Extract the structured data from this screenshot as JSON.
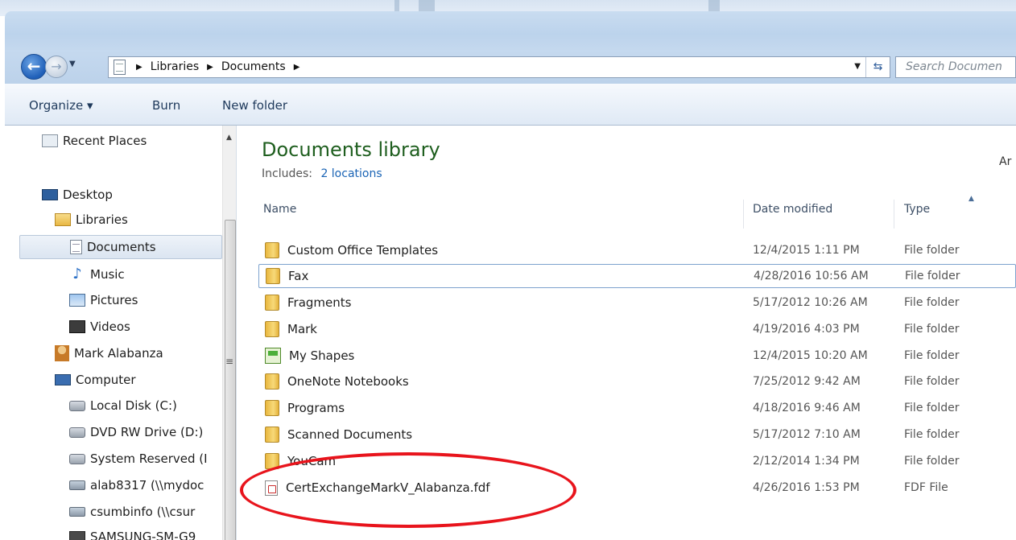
{
  "address_bar": {
    "crumbs": [
      "Libraries",
      "Documents"
    ],
    "search_placeholder": "Search Documen"
  },
  "toolbar": {
    "organize": "Organize ▾",
    "burn": "Burn",
    "new_folder": "New folder"
  },
  "nav_pane": {
    "items": [
      {
        "label": "Recent Places",
        "icon": "recent-places-icon"
      },
      {
        "label": "Desktop",
        "icon": "desktop-icon"
      },
      {
        "label": "Libraries",
        "icon": "libraries-icon"
      },
      {
        "label": "Documents",
        "icon": "documents-icon"
      },
      {
        "label": "Music",
        "icon": "music-icon"
      },
      {
        "label": "Pictures",
        "icon": "pictures-icon"
      },
      {
        "label": "Videos",
        "icon": "videos-icon"
      },
      {
        "label": "Mark Alabanza",
        "icon": "user-icon"
      },
      {
        "label": "Computer",
        "icon": "computer-icon"
      },
      {
        "label": "Local Disk (C:)",
        "icon": "local-disk-icon"
      },
      {
        "label": "DVD RW Drive (D:)",
        "icon": "dvd-drive-icon"
      },
      {
        "label": "System Reserved (I",
        "icon": "disk-icon"
      },
      {
        "label": "alab8317 (\\\\mydoc",
        "icon": "network-drive-icon"
      },
      {
        "label": "csumbinfo (\\\\csur",
        "icon": "network-drive-icon"
      },
      {
        "label": "SAMSUNG-SM-G9",
        "icon": "phone-icon"
      }
    ]
  },
  "library": {
    "title": "Documents library",
    "includes_label": "Includes:",
    "includes_link": "2 locations",
    "arrange_cut": "Ar"
  },
  "columns": {
    "name": "Name",
    "date": "Date modified",
    "type": "Type"
  },
  "files": [
    {
      "name": "Custom Office Templates",
      "date": "12/4/2015 1:11 PM",
      "type": "File folder",
      "icon": "folder-icon"
    },
    {
      "name": "Fax",
      "date": "4/28/2016 10:56 AM",
      "type": "File folder",
      "icon": "folder-icon"
    },
    {
      "name": "Fragments",
      "date": "5/17/2012 10:26 AM",
      "type": "File folder",
      "icon": "folder-icon"
    },
    {
      "name": "Mark",
      "date": "4/19/2016 4:03 PM",
      "type": "File folder",
      "icon": "folder-icon"
    },
    {
      "name": "My Shapes",
      "date": "12/4/2015 10:20 AM",
      "type": "File folder",
      "icon": "shapes-folder-icon"
    },
    {
      "name": "OneNote Notebooks",
      "date": "7/25/2012 9:42 AM",
      "type": "File folder",
      "icon": "folder-icon"
    },
    {
      "name": "Programs",
      "date": "4/18/2016 9:46 AM",
      "type": "File folder",
      "icon": "folder-icon"
    },
    {
      "name": "Scanned Documents",
      "date": "5/17/2012 7:10 AM",
      "type": "File folder",
      "icon": "folder-icon"
    },
    {
      "name": "YouCam",
      "date": "2/12/2014 1:34 PM",
      "type": "File folder",
      "icon": "folder-icon"
    },
    {
      "name": "CertExchangeMarkV_Alabanza.fdf",
      "date": "4/26/2016 1:53 PM",
      "type": "FDF File",
      "icon": "fdf-file-icon"
    }
  ],
  "colors": {
    "title_green": "#1e5e1e",
    "link_blue": "#1a64b5",
    "annotation_red": "#e8141c"
  }
}
